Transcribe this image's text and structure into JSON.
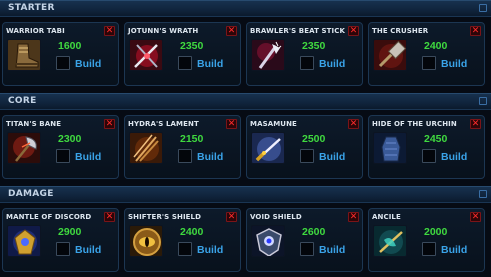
{
  "sections": [
    {
      "title": "STARTER",
      "items": [
        {
          "name": "WARRIOR TABI",
          "price": "1600",
          "build_label": "Build",
          "icon": "boot-icon",
          "remove": "✕"
        },
        {
          "name": "JOTUNN'S WRATH",
          "price": "2350",
          "build_label": "Build",
          "icon": "crossed-blades-icon",
          "remove": "✕"
        },
        {
          "name": "BRAWLER'S BEAT STICK",
          "price": "2350",
          "build_label": "Build",
          "icon": "spiked-club-icon",
          "remove": "✕"
        },
        {
          "name": "THE CRUSHER",
          "price": "2400",
          "build_label": "Build",
          "icon": "hammer-icon",
          "remove": "✕"
        }
      ]
    },
    {
      "title": "CORE",
      "items": [
        {
          "name": "TITAN'S BANE",
          "price": "2300",
          "build_label": "Build",
          "icon": "axe-icon",
          "remove": "✕"
        },
        {
          "name": "HYDRA'S LAMENT",
          "price": "2150",
          "build_label": "Build",
          "icon": "trident-icon",
          "remove": "✕"
        },
        {
          "name": "MASAMUNE",
          "price": "2500",
          "build_label": "Build",
          "icon": "katana-icon",
          "remove": "✕"
        },
        {
          "name": "HIDE OF THE URCHIN",
          "price": "2450",
          "build_label": "Build",
          "icon": "hide-armor-icon",
          "remove": "✕"
        }
      ]
    },
    {
      "title": "DAMAGE",
      "items": [
        {
          "name": "MANTLE OF DISCORD",
          "price": "2900",
          "build_label": "Build",
          "icon": "mantle-icon",
          "remove": "✕"
        },
        {
          "name": "SHIFTER'S SHIELD",
          "price": "2400",
          "build_label": "Build",
          "icon": "eye-shield-icon",
          "remove": "✕"
        },
        {
          "name": "VOID SHIELD",
          "price": "2600",
          "build_label": "Build",
          "icon": "void-shield-icon",
          "remove": "✕"
        },
        {
          "name": "ANCILE",
          "price": "2000",
          "build_label": "Build",
          "icon": "winged-spear-icon",
          "remove": "✕"
        }
      ]
    }
  ],
  "colors": {
    "price": "#3fd93f",
    "build": "#3aa3e8",
    "remove": "#ff2c2c",
    "header_text": "#c4d4e6"
  }
}
